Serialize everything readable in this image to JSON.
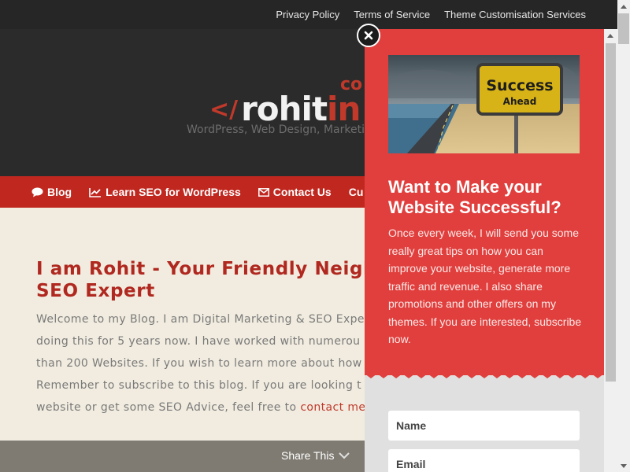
{
  "topbar": {
    "links": [
      "Privacy Policy",
      "Terms of Service",
      "Theme Customisation Services"
    ]
  },
  "header": {
    "logo": {
      "prefix": "</",
      "text_main": "rohit",
      "text_accent": "in",
      "superscript": "co"
    },
    "tagline": "WordPress, Web Design, Marketing"
  },
  "nav": {
    "items": [
      {
        "label": "Blog",
        "icon": "comment-icon"
      },
      {
        "label": "Learn SEO for WordPress",
        "icon": "chart-icon"
      },
      {
        "label": "Contact Us",
        "icon": "envelope-icon"
      },
      {
        "label": "Cu",
        "icon": ""
      }
    ]
  },
  "content": {
    "heading_lines": [
      "I am Rohit - Your Friendly Neigh",
      "SEO Expert"
    ],
    "paragraph_lines": [
      "Welcome to my Blog. I am Digital Marketing & SEO Expe",
      "doing this for 5 years now. I have worked with numerou",
      "than 200 Websites. If you wish to learn more about how",
      "Remember to subscribe to this blog. If you are looking t",
      "website or get some SEO Advice, feel free to "
    ],
    "link_text": "contact me"
  },
  "share": {
    "label": "Share This"
  },
  "popup": {
    "image_sign_line1": "Success",
    "image_sign_line2": "Ahead",
    "title": "Want to Make your Website Successful?",
    "description": "Once every week, I will send you some really great tips on how you can improve your website, generate more traffic and revenue. I also share promotions and other offers on my themes. If you are interested, subscribe now.",
    "name_placeholder": "Name",
    "email_placeholder": "Email",
    "accent_color": "#e03f3d"
  }
}
